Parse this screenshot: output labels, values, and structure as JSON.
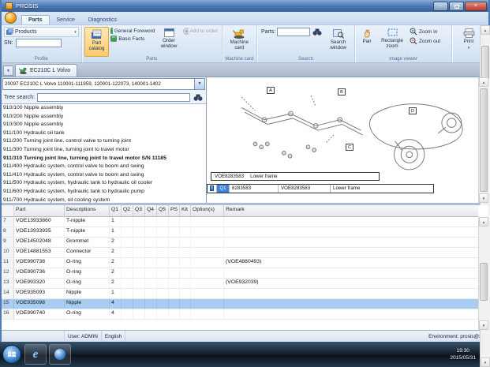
{
  "window": {
    "title": "PROSIS",
    "minimize": "–",
    "close": "×"
  },
  "ribbon_tabs": {
    "parts": "Parts",
    "service": "Service",
    "diagnostics": "Diagnostics"
  },
  "ribbon": {
    "profile": {
      "products": "Products",
      "sn": "SN:",
      "sn_value": "",
      "label": "Profile"
    },
    "parts": {
      "part_catalog": "Part catalog",
      "general_foreword": "General Foreword",
      "basic_facts": "Basic Facts",
      "order_window": "Order window",
      "add_to_order": "Add to order",
      "label": "Parts"
    },
    "machine": {
      "machine_card": "Machine card",
      "label": "Machine card"
    },
    "search": {
      "parts": "Parts:",
      "parts_value": "",
      "search_window": "Search window",
      "label": "Search"
    },
    "viewer": {
      "pan": "Pan",
      "rectangle_zoom": "Rectangle zoom",
      "zoom_in": "Zoom In",
      "zoom_out": "Zoom out",
      "label": "Image viewer"
    },
    "print": {
      "label": "Print"
    }
  },
  "doc_tab": "EC210C L Volvo",
  "model_selector": "20097 EC210C L Volvo 110001-111959, 120001-122073, 140001-1402",
  "tree": {
    "search_label": "Tree search:",
    "search_value": "",
    "items": [
      {
        "text": "910/100 Nipple assembly"
      },
      {
        "text": "910/200 Nipple assembly"
      },
      {
        "text": "910/300 Nipple assembly"
      },
      {
        "text": "911/100 Hydraulic oil tank"
      },
      {
        "text": "911/200 Turning joint line, control valve to turning joint"
      },
      {
        "text": "911/300 Turning joint line, turning joint to travel motor"
      },
      {
        "text": "911/310 Turning joint line, turning joint to travel motor S/N 11185",
        "selected": true
      },
      {
        "text": "911/400 Hydraulic system, control valve to boom and swing"
      },
      {
        "text": "911/410 Hydraulic system, control valve to boom and swing"
      },
      {
        "text": "911/500 Hydraulic system, hydraulic tank to hydraulic oil cooler"
      },
      {
        "text": "911/600 Hydraulic system, hydraulic tank to hydraulic pump"
      },
      {
        "text": "911/700 Hydraulic system, oil cooling system"
      }
    ]
  },
  "image_viewer": {
    "callouts": {
      "a": "A",
      "b": "B",
      "c": "C",
      "d": "D"
    },
    "tooltip": {
      "part": "VOE8283583",
      "desc": "Lower frame"
    },
    "strip": {
      "q": "Q1",
      "part": "8283583",
      "part_full": "VOE8283583",
      "desc": "Lower frame"
    }
  },
  "table": {
    "columns": [
      "",
      "Part",
      "Descriptions",
      "Q1",
      "Q2",
      "Q3",
      "Q4",
      "Q5",
      "PS",
      "Kit",
      "Option(s)",
      "Remark"
    ],
    "rows": [
      {
        "num": "7",
        "part": "VOE13933860",
        "desc": "T-nipple",
        "q1": "1"
      },
      {
        "num": "8",
        "part": "VOE13933935",
        "desc": "T-nipple",
        "q1": "1"
      },
      {
        "num": "9",
        "part": "VOE14502048",
        "desc": "Grommet",
        "q1": "2"
      },
      {
        "num": "10",
        "part": "VOE14881553",
        "desc": "Connector",
        "q1": "2"
      },
      {
        "num": "11",
        "part": "VOE990738",
        "desc": "O-ring",
        "q1": "2",
        "remark": "(VOE4880493)"
      },
      {
        "num": "12",
        "part": "VOE990736",
        "desc": "O-ring",
        "q1": "2"
      },
      {
        "num": "13",
        "part": "VOE993320",
        "desc": "O-ring",
        "q1": "2",
        "remark": "(VOE932039)"
      },
      {
        "num": "14",
        "part": "VOE935093",
        "desc": "Nipple",
        "q1": "1"
      },
      {
        "num": "15",
        "part": "VOE935098",
        "desc": "Nipple",
        "q1": "4",
        "selected": true
      },
      {
        "num": "16",
        "part": "VOE990740",
        "desc": "O-ring",
        "q1": "4"
      }
    ]
  },
  "status_bar": {
    "user": "User: ADMIN",
    "language": "English",
    "environment": "Environment: prosis@xe"
  },
  "taskbar": {
    "time": "19:30",
    "date": "2015/05/31"
  }
}
